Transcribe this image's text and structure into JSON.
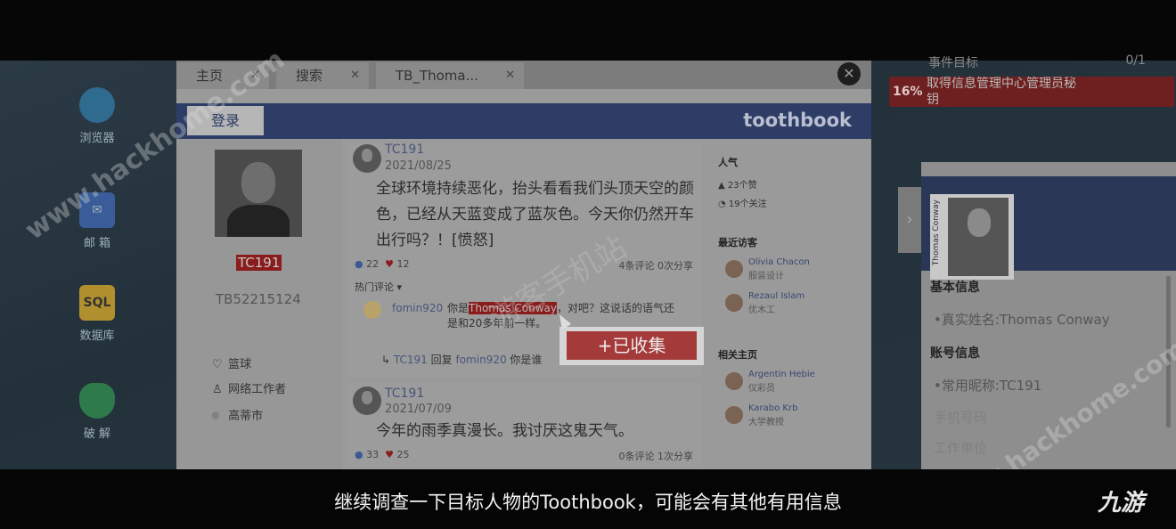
{
  "desktop": {
    "icons": [
      {
        "label": "浏览器",
        "name": "browser"
      },
      {
        "label": "邮 箱",
        "name": "mail"
      },
      {
        "label": "数据库",
        "name": "database"
      },
      {
        "label": "破 解",
        "name": "crack"
      }
    ],
    "db_badge": "SQL"
  },
  "browser": {
    "tabs": [
      {
        "label": "主页"
      },
      {
        "label": "搜索"
      },
      {
        "label": "TB_Thoma..."
      }
    ],
    "close_glyph": "✕",
    "login_label": "登录",
    "brand": "toothbook"
  },
  "profile": {
    "name": "TC191",
    "id": "TB52215124",
    "info": [
      {
        "icon": "heart-outline",
        "text": "篮球"
      },
      {
        "icon": "tie",
        "text": "网络工作者"
      },
      {
        "icon": "location-pin",
        "text": "高蒂市"
      }
    ]
  },
  "posts": [
    {
      "user": "TC191",
      "date": "2021/08/25",
      "body": "全球环境持续恶化，抬头看看我们头顶天空的颜色，已经从天蓝变成了蓝灰色。今天你仍然开车出行吗？！[愤怒]",
      "likes": "22",
      "hearts": "12",
      "comments": "4条评论",
      "shares": "0次分享"
    },
    {
      "user": "TC191",
      "date": "2021/07/09",
      "body": "今年的雨季真漫长。我讨厌这鬼天气。",
      "likes": "33",
      "hearts": "25",
      "comments": "0条评论",
      "shares": "1次分享"
    }
  ],
  "hot_comments_label": "热门评论 ▾",
  "comment": {
    "user": "fomin920",
    "text_pre": "你是",
    "highlight": "Thomas Conway",
    "text_post": "，对吧？这说话的语气还是和20多年前一样。"
  },
  "reply": {
    "user": "TC191",
    "verb": "回复",
    "target": "fomin920",
    "text": "你是谁"
  },
  "sidebar": {
    "popularity_title": "人气",
    "likes": "23个赞",
    "follows": "19个关注",
    "visitors_title": "最近访客",
    "visitors": [
      {
        "name": "Olivia Chacon",
        "role": "服装设计"
      },
      {
        "name": "Rezaul Islam",
        "role": "优木工"
      }
    ],
    "related_title": "相关主页",
    "related": [
      {
        "name": "Argentin Hebie",
        "role": "仪彩员"
      },
      {
        "name": "Karabo Krb",
        "role": "大学教授"
      }
    ]
  },
  "collect_label": "+已收集",
  "task": {
    "header": "事件目标",
    "count": "0/1",
    "percent": "16%",
    "goal": "取得信息管理中心管理员秘钥"
  },
  "dossier": {
    "photo_caption": "Thomas Conway",
    "section1": "基本信息",
    "real_name": "•真实姓名:Thomas Conway",
    "section2": "账号信息",
    "nickname": "•常用昵称:TC191",
    "faded1": "手机号码",
    "faded2": "工作单位"
  },
  "watermarks": {
    "site": "www.hackhome.com",
    "cn": "游客手机站"
  },
  "subtitle": "继续调查一下目标人物的Toothbook，可能会有其他有用信息",
  "logo": "九游"
}
